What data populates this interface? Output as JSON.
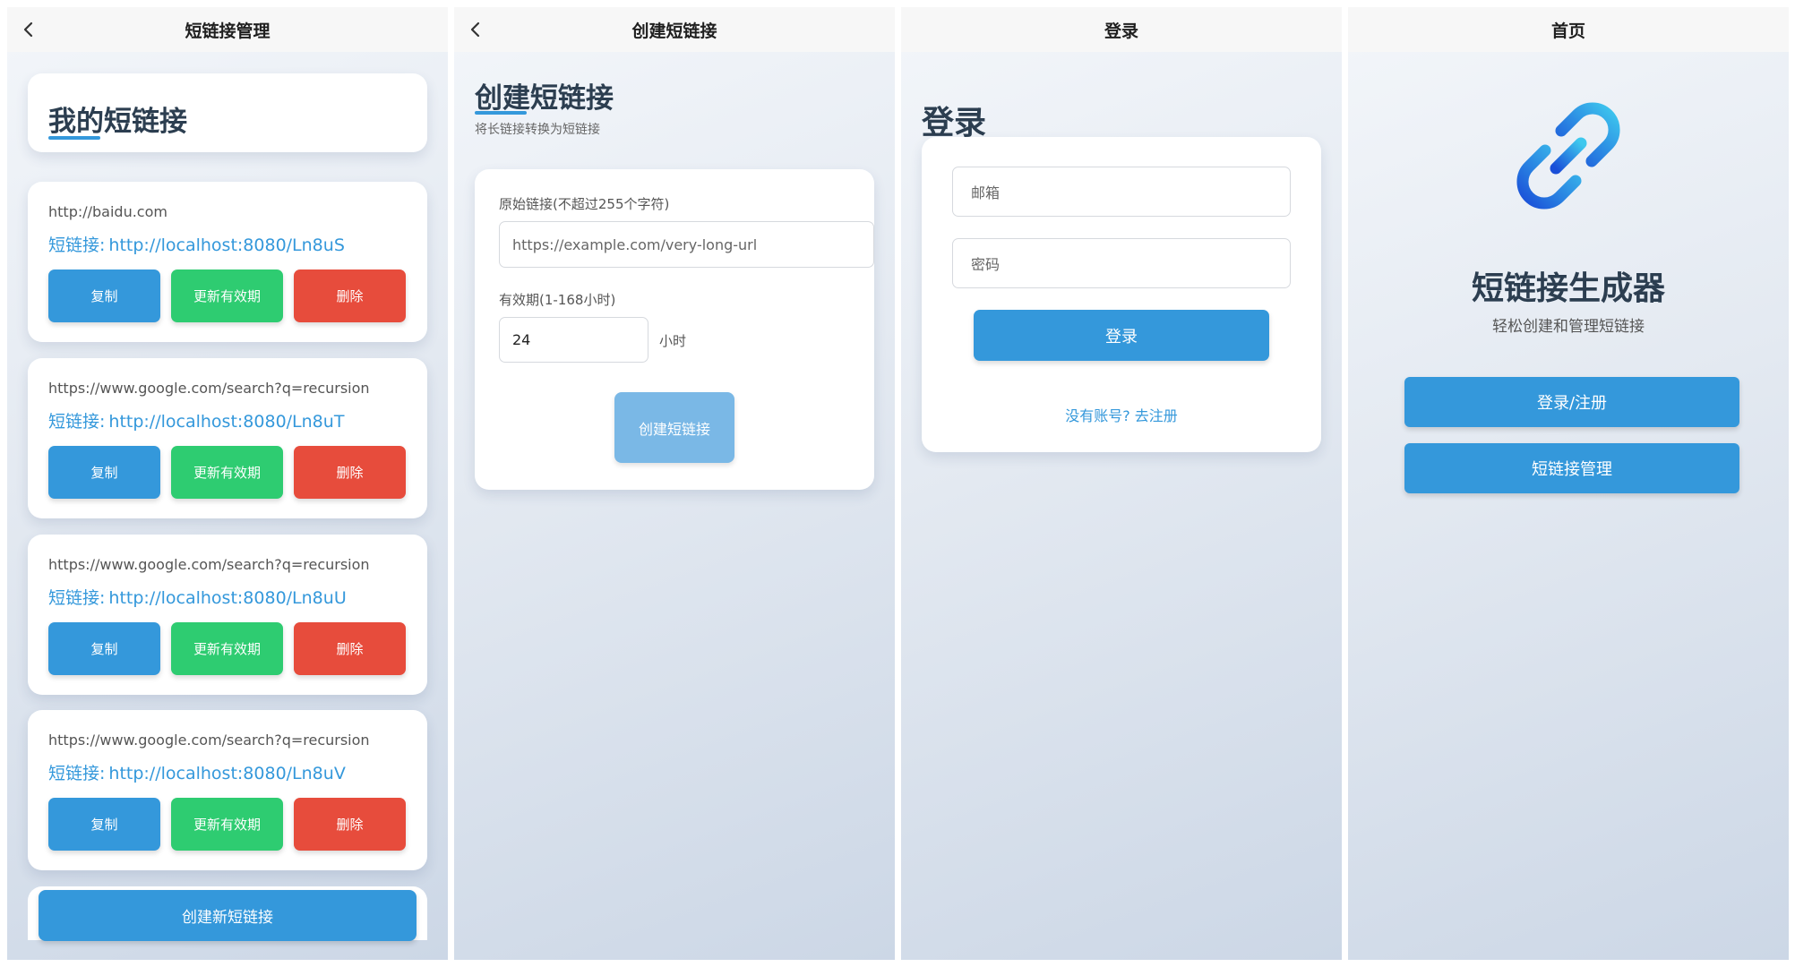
{
  "screens": {
    "manage": {
      "nav_title": "短链接管理",
      "heading": "我的短链接",
      "links": [
        {
          "original": "http://baidu.com",
          "short_label": "短链接:",
          "short_url": "http://localhost:8080/Ln8uS"
        },
        {
          "original": "https://www.google.com/search?q=recursion",
          "short_label": "短链接:",
          "short_url": "http://localhost:8080/Ln8uT"
        },
        {
          "original": "https://www.google.com/search?q=recursion",
          "short_label": "短链接:",
          "short_url": "http://localhost:8080/Ln8uU"
        },
        {
          "original": "https://www.google.com/search?q=recursion",
          "short_label": "短链接:",
          "short_url": "http://localhost:8080/Ln8uV"
        }
      ],
      "copy_label": "复制",
      "renew_label": "更新有效期",
      "delete_label": "删除",
      "create_new_label": "创建新短链接"
    },
    "create": {
      "nav_title": "创建短链接",
      "heading": "创建短链接",
      "subtitle": "将长链接转换为短链接",
      "original_label": "原始链接(不超过255个字符)",
      "original_placeholder": "https://example.com/very-long-url",
      "expiry_label": "有效期(1-168小时)",
      "expiry_value": "24",
      "expiry_unit": "小时",
      "submit_label": "创建短链接"
    },
    "login": {
      "nav_title": "登录",
      "heading": "登录",
      "email_placeholder": "邮箱",
      "password_placeholder": "密码",
      "submit_label": "登录",
      "register_link": "没有账号? 去注册"
    },
    "home": {
      "nav_title": "首页",
      "app_title": "短链接生成器",
      "app_subtitle": "轻松创建和管理短链接",
      "login_register_label": "登录/注册",
      "manage_label": "短链接管理",
      "logo_icon": "link-chain-icon"
    }
  },
  "colors": {
    "primary": "#3498db",
    "success": "#2ecc71",
    "danger": "#e74c3c",
    "disabled_primary": "#7ab8e6",
    "title": "#2c3e50"
  }
}
